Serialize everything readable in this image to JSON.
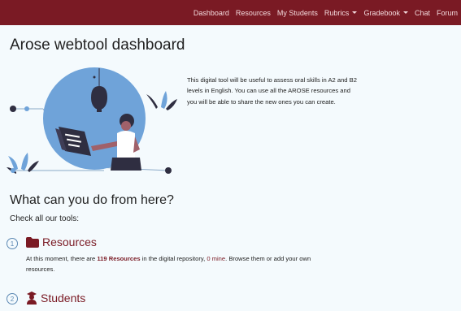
{
  "nav": {
    "items": [
      {
        "label": "Dashboard",
        "dropdown": false
      },
      {
        "label": "Resources",
        "dropdown": false
      },
      {
        "label": "My Students",
        "dropdown": false
      },
      {
        "label": "Rubrics",
        "dropdown": true
      },
      {
        "label": "Gradebook",
        "dropdown": true
      },
      {
        "label": "Chat",
        "dropdown": false
      },
      {
        "label": "Forum",
        "dropdown": false
      }
    ]
  },
  "page": {
    "title": "Arose webtool dashboard",
    "intro": "This digital tool will be useful to assess oral skills in A2 and B2 levels in English. You can use all the AROSE resources and you will be able to share the new ones you can create.",
    "illustration_icon": "woman-reading-book-illustration"
  },
  "tools_section": {
    "heading": "What can you do from here?",
    "subheading": "Check all our tools:"
  },
  "tools": [
    {
      "number": "1",
      "icon": "folder-icon",
      "title": "Resources",
      "desc_prefix": "At this moment, there are ",
      "count_text": "119 Resources",
      "desc_mid": " in the digital repository, ",
      "mine_text": "0 mine",
      "desc_suffix": ". Browse them or add your own resources."
    },
    {
      "number": "2",
      "icon": "graduate-user-icon",
      "title": "Students"
    }
  ],
  "colors": {
    "brand": "#7a1a24",
    "accent_blue": "#5b88b3",
    "illustration_blue": "#6fa3d9",
    "background": "#f4fafd"
  }
}
